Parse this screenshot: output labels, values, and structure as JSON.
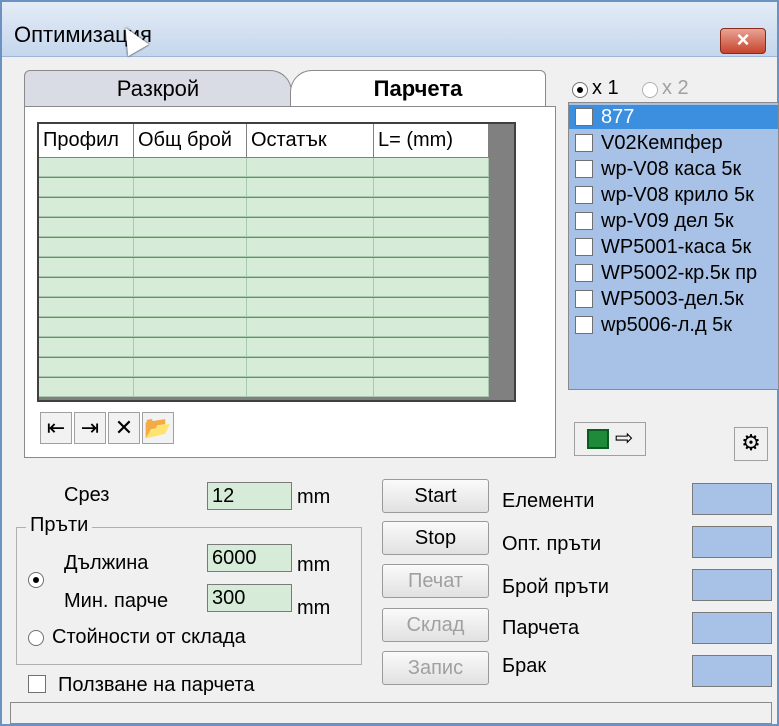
{
  "window": {
    "title": "Оптимизация",
    "close_icon": "×"
  },
  "tabs": [
    {
      "label": "Разкрой"
    },
    {
      "label": "Парчета"
    }
  ],
  "grid": {
    "columns": [
      "Профил",
      "Общ брой",
      "Остатък",
      "L= (mm)"
    ],
    "row_count": 12
  },
  "grid_toolbar": [
    "import-icon",
    "export-icon",
    "delete-icon",
    "open-folder-icon"
  ],
  "multiplier": {
    "x1": "x 1",
    "x2": "x 2",
    "selected": "x1"
  },
  "profiles": [
    {
      "label": "877",
      "selected": true
    },
    {
      "label": "V02Кемпфер"
    },
    {
      "label": "wp-V08 каса 5к"
    },
    {
      "label": "wp-V08 крило 5к"
    },
    {
      "label": "wp-V09 дел 5к"
    },
    {
      "label": "WP5001-каса 5к"
    },
    {
      "label": "WP5002-кр.5к пр"
    },
    {
      "label": "WP5003-дел.5к"
    },
    {
      "label": "wp5006-л.д  5к"
    }
  ],
  "cut": {
    "label": "Срез",
    "value": "12",
    "unit": "mm"
  },
  "bars": {
    "group": "Пръти",
    "length_label": "Дължина",
    "length_value": "6000",
    "length_unit": "mm",
    "min_label": "Мин. парче",
    "min_value": "300",
    "min_unit": "mm",
    "stock_label": "Стойности от склада"
  },
  "use_pieces_label": "Ползване на парчета",
  "buttons": {
    "start": "Start",
    "stop": "Stop",
    "print": "Печат",
    "stock": "Склад",
    "save": "Запис"
  },
  "results": [
    {
      "label": "Елементи",
      "value": ""
    },
    {
      "label": "Опт. пръти",
      "value": ""
    },
    {
      "label": "Брой пръти",
      "value": ""
    },
    {
      "label": "Парчета",
      "value": ""
    },
    {
      "label": "Брак",
      "value": ""
    }
  ],
  "colors": {
    "accent": "#3b8fde",
    "list_bg": "#a8c1e6",
    "grid_bg": "#d6ecd8"
  }
}
